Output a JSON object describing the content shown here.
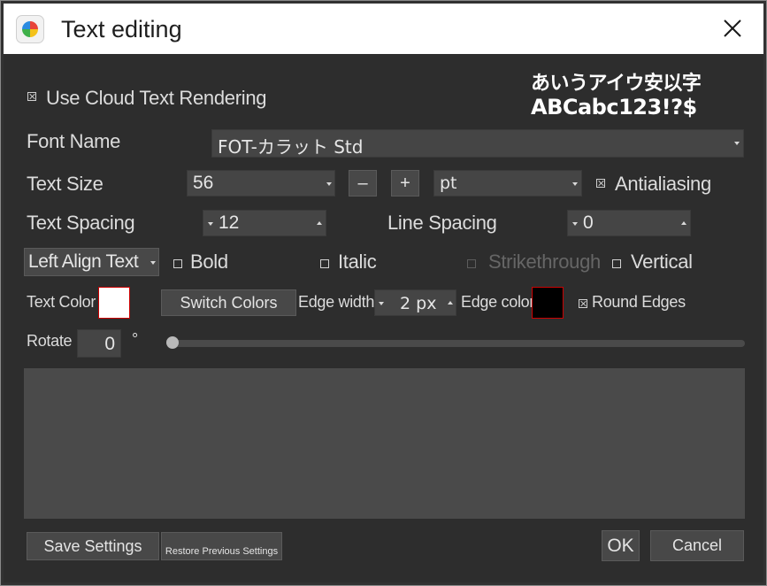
{
  "window": {
    "title": "Text editing",
    "app_icon": "color-drop-icon",
    "close_icon": "close-icon"
  },
  "cloud": {
    "label": "Use Cloud Text Rendering",
    "checked": true
  },
  "sample_preview": {
    "line1": "あいうアイウ安以字",
    "line2": "ABCabc123!?$"
  },
  "font": {
    "label": "Font Name",
    "value": "FOT-カラット Std"
  },
  "size": {
    "label": "Text Size",
    "value": "56",
    "minus": "–",
    "plus": "+",
    "unit": "pt"
  },
  "antialiasing": {
    "label": "Antialiasing",
    "checked": true
  },
  "spacing": {
    "label": "Text Spacing",
    "value": "12"
  },
  "line_spacing": {
    "label": "Line Spacing",
    "value": "0"
  },
  "align": {
    "value": "Left Align Text"
  },
  "bold": {
    "label": "Bold",
    "checked": false
  },
  "italic": {
    "label": "Italic",
    "checked": false
  },
  "strike": {
    "label": "Strikethrough",
    "checked": false,
    "enabled": false
  },
  "vertical": {
    "label": "Vertical",
    "checked": false
  },
  "text_color": {
    "label": "Text Color",
    "color": "#ffffff"
  },
  "switch_colors": {
    "label": "Switch Colors"
  },
  "edge_width": {
    "label": "Edge width",
    "value": "2 px"
  },
  "edge_color": {
    "label": "Edge color",
    "color": "#000000"
  },
  "round_edges": {
    "label": "Round Edges",
    "checked": true
  },
  "rotate": {
    "label": "Rotate",
    "value": "0",
    "unit": "°",
    "slider_value": 0
  },
  "buttons": {
    "save": "Save Settings",
    "restore": "Restore Previous Settings",
    "ok": "OK",
    "cancel": "Cancel"
  },
  "colors": {
    "accent_border": "#cc0000",
    "dialog_bg": "#2d2d2d"
  }
}
